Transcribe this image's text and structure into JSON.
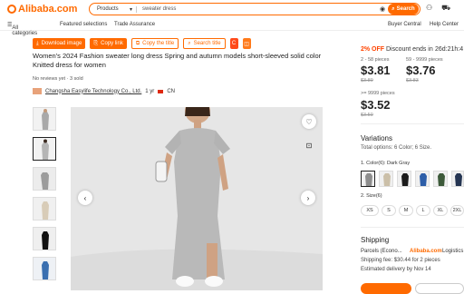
{
  "header": {
    "logo_text": "Alibaba.com",
    "search_category": "Products",
    "search_query": "sweater dress",
    "search_button": "Search",
    "accent_color": "#ff6a00"
  },
  "nav": {
    "all_categories": "All categories",
    "featured": "Featured selections",
    "trade": "Trade Assurance",
    "buyer_central": "Buyer Central",
    "help_center": "Help Center"
  },
  "toolbar": {
    "download": "Download image",
    "copy_link": "Copy link",
    "copy_title": "Copy the title",
    "search_title": "Search title"
  },
  "product": {
    "title": "Women's 2024 Fashion sweater long dress Spring and autumn models short-sleeved solid color Knitted dress for women",
    "reviews": "No reviews yet · 3 sold",
    "supplier": "Changsha Easylife Technology Co., Ltd.",
    "supplier_years": "1 yr",
    "country": "CN"
  },
  "pricing": {
    "discount": "2% OFF",
    "discount_label": "Discount ends in",
    "countdown": "26d:21h:4",
    "tiers": [
      {
        "range": "2 - 58 pieces",
        "price": "$3.81",
        "old": "$3.89"
      },
      {
        "range": "59 - 9999 pieces",
        "price": "$3.76",
        "old": "$3.83"
      }
    ],
    "top_range": ">= 9999 pieces",
    "top_price": "$3.52",
    "top_old": "$3.59"
  },
  "variations": {
    "heading": "Variations",
    "total": "Total options: 6 Color; 6 Size.",
    "color_label": "1. Color(6): Dark Gray",
    "size_label": "2. Size(6)",
    "sizes": [
      "XS",
      "S",
      "M",
      "L",
      "XL",
      "2XL"
    ]
  },
  "shipping": {
    "heading": "Shipping",
    "method": "Parcels (Econo...",
    "logistics_brand": "Alibaba.com",
    "logistics_word": "Logistics",
    "fee": "Shipping fee: $30.44 for 2 pieces",
    "delivery": "Estimated delivery by Nov 14"
  }
}
